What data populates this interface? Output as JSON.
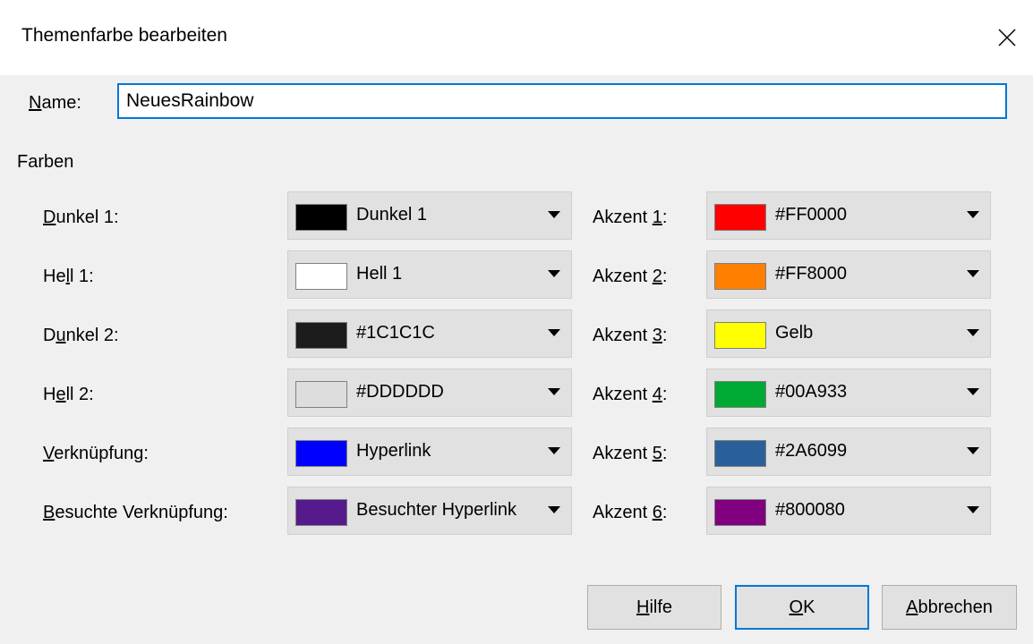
{
  "dialog": {
    "title": "Themenfarbe bearbeiten"
  },
  "name": {
    "label_ul": "N",
    "label_rest": "ame:",
    "value": "NeuesRainbow"
  },
  "section_label": "Farben",
  "rows_left": [
    {
      "label_pre": "",
      "label_ul": "D",
      "label_post": "unkel 1:",
      "color": "#000000",
      "text": "Dunkel 1"
    },
    {
      "label_pre": "He",
      "label_ul": "l",
      "label_post": "l 1:",
      "color": "#FFFFFF",
      "text": "Hell 1"
    },
    {
      "label_pre": "D",
      "label_ul": "u",
      "label_post": "nkel 2:",
      "color": "#1C1C1C",
      "text": "#1C1C1C"
    },
    {
      "label_pre": "H",
      "label_ul": "e",
      "label_post": "ll 2:",
      "color": "#DDDDDD",
      "text": "#DDDDDD"
    },
    {
      "label_pre": "",
      "label_ul": "V",
      "label_post": "erknüpfung:",
      "color": "#0000FF",
      "text": "Hyperlink"
    },
    {
      "label_pre": "",
      "label_ul": "B",
      "label_post": "esuchte Verknüpfung:",
      "color": "#551A8B",
      "text": "Besuchter Hyperlink"
    }
  ],
  "rows_right": [
    {
      "label_pre": "Akzent ",
      "label_ul": "1",
      "label_post": ":",
      "color": "#FF0000",
      "text": "#FF0000"
    },
    {
      "label_pre": "Akzent ",
      "label_ul": "2",
      "label_post": ":",
      "color": "#FF8000",
      "text": "#FF8000"
    },
    {
      "label_pre": "Akzent ",
      "label_ul": "3",
      "label_post": ":",
      "color": "#FFFF00",
      "text": "Gelb"
    },
    {
      "label_pre": "Akzent ",
      "label_ul": "4",
      "label_post": ":",
      "color": "#00A933",
      "text": "#00A933"
    },
    {
      "label_pre": "Akzent ",
      "label_ul": "5",
      "label_post": ":",
      "color": "#2A6099",
      "text": "#2A6099"
    },
    {
      "label_pre": "Akzent ",
      "label_ul": "6",
      "label_post": ":",
      "color": "#800080",
      "text": "#800080"
    }
  ],
  "buttons": {
    "help": {
      "ul": "H",
      "rest": "ilfe"
    },
    "ok": {
      "ul": "O",
      "rest": "K"
    },
    "cancel": {
      "ul": "A",
      "rest": "bbrechen"
    }
  },
  "colors": {
    "accent": "#0078D7",
    "dialog_bg": "#F0F0F0",
    "button_bg": "#E1E1E1"
  }
}
